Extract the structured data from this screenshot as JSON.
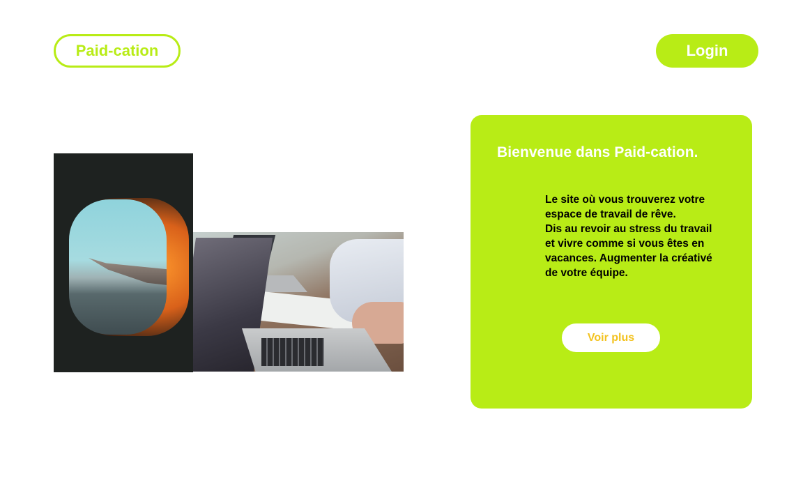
{
  "header": {
    "logo_label": "Paid-cation",
    "login_label": "Login"
  },
  "images": [
    {
      "name": "airplane-window-photo"
    },
    {
      "name": "laptop-meeting-photo"
    }
  ],
  "card": {
    "title": "Bienvenue dans Paid-cation.",
    "text_lines": [
      "Le site où vous trouverez votre",
      "espace de travail de rêve.",
      "Dis au revoir au stress du travail",
      "et vivre comme si vous êtes en",
      "vacances. Augmenter la créativé",
      "de votre équipe."
    ],
    "button_label": "Voir plus"
  },
  "colors": {
    "accent": "#b8ec16",
    "button_text": "#f3c21f",
    "white": "#ffffff"
  }
}
